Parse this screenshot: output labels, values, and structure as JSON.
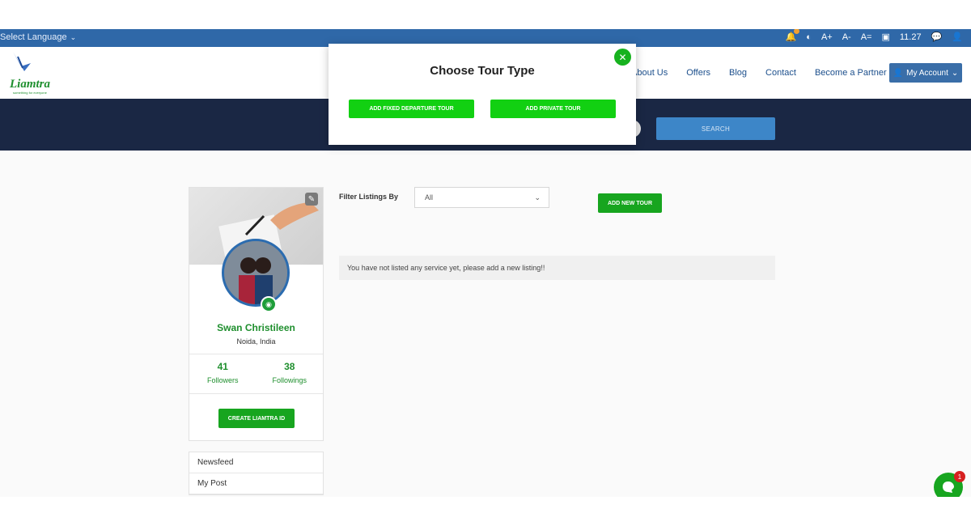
{
  "topbar": {
    "language_label": "Select Language",
    "tools": [
      "A+",
      "A-",
      "A="
    ],
    "score": "11.27"
  },
  "header": {
    "logo_text": "Liamtra",
    "nav": [
      "About Us",
      "Offers",
      "Blog",
      "Contact",
      "Become a Partner"
    ],
    "account_label": "My Account"
  },
  "search": {
    "button_label": "SEARCH"
  },
  "profile": {
    "name": "Swan Christileen",
    "location": "Noida, India",
    "followers_count": "41",
    "followers_label": "Followers",
    "followings_count": "38",
    "followings_label": "Followings",
    "create_id_label": "CREATE LIAMTRA ID"
  },
  "menu": {
    "items": [
      "Newsfeed",
      "My Post"
    ]
  },
  "listings": {
    "filter_label": "Filter Listings By",
    "filter_value": "All",
    "add_new_label": "ADD NEW TOUR",
    "empty_message": "You have not listed any service yet, please add a new listing!!"
  },
  "modal": {
    "title": "Choose Tour Type",
    "fixed_label": "ADD FIXED DEPARTURE TOUR",
    "private_label": "ADD PRIVATE TOUR"
  },
  "chat": {
    "badge": "1"
  },
  "colors": {
    "accent_green": "#17a51f",
    "topbar_blue": "#2f68a8",
    "band_navy": "#1a2744"
  }
}
